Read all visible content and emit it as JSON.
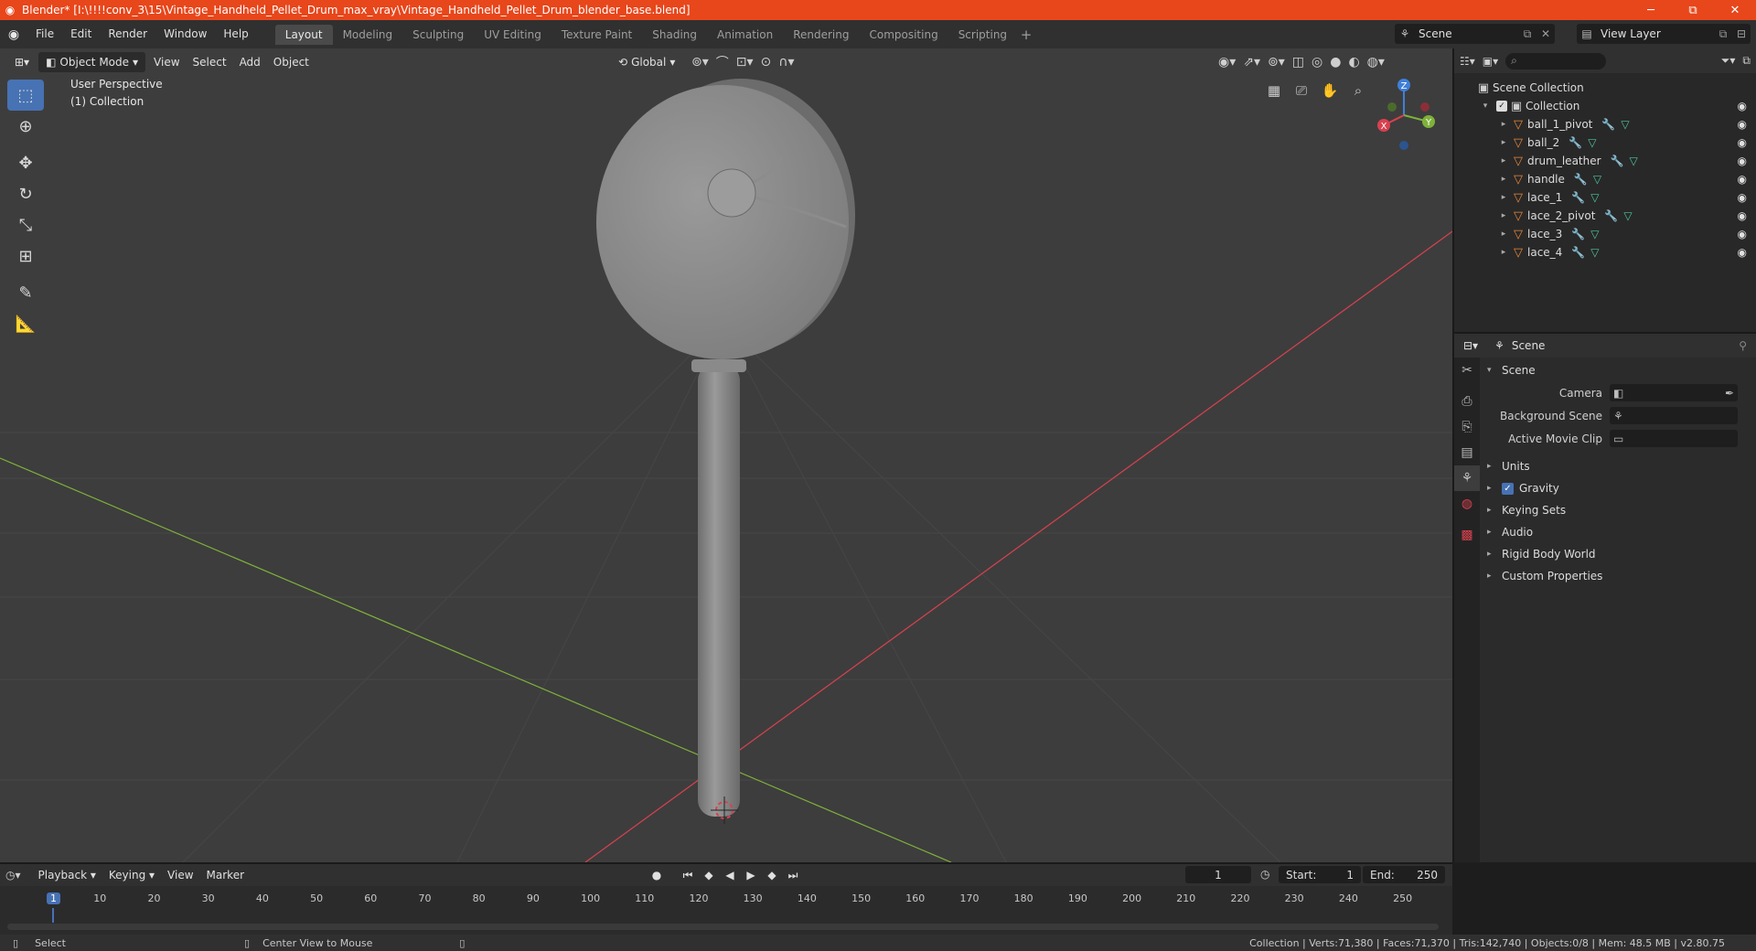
{
  "window": {
    "title": "Blender* [I:\\!!!!conv_3\\15\\Vintage_Handheld_Pellet_Drum_max_vray\\Vintage_Handheld_Pellet_Drum_blender_base.blend]",
    "minimize": "─",
    "maximize": "⧉",
    "close": "✕"
  },
  "menu": [
    "File",
    "Edit",
    "Render",
    "Window",
    "Help"
  ],
  "workspaces": [
    "Layout",
    "Modeling",
    "Sculpting",
    "UV Editing",
    "Texture Paint",
    "Shading",
    "Animation",
    "Rendering",
    "Compositing",
    "Scripting"
  ],
  "active_workspace": "Layout",
  "scene_selector": "Scene",
  "view_layer_selector": "View Layer",
  "viewport": {
    "mode": "Object Mode",
    "menus": [
      "View",
      "Select",
      "Add",
      "Object"
    ],
    "transform_orientation": "Global",
    "perspective_label": "User Perspective",
    "collection_label": "(1) Collection",
    "gizmo": {
      "x": "X",
      "y": "Y",
      "z": "Z"
    }
  },
  "tools": [
    "select-box",
    "cursor",
    "move",
    "rotate",
    "scale",
    "transform",
    "annotate",
    "measure"
  ],
  "outliner": {
    "root": "Scene Collection",
    "collection": "Collection",
    "objects": [
      "ball_1_pivot",
      "ball_2",
      "drum_leather",
      "handle",
      "lace_1",
      "lace_2_pivot",
      "lace_3",
      "lace_4"
    ]
  },
  "properties": {
    "header": "Scene",
    "panel": "Scene",
    "fields": [
      {
        "label": "Camera",
        "value": ""
      },
      {
        "label": "Background Scene",
        "value": ""
      },
      {
        "label": "Active Movie Clip",
        "value": ""
      }
    ],
    "subpanels": [
      "Units",
      "Gravity",
      "Keying Sets",
      "Audio",
      "Rigid Body World",
      "Custom Properties"
    ],
    "gravity_checked": true
  },
  "timeline": {
    "menus": [
      "Playback",
      "Keying",
      "View",
      "Marker"
    ],
    "current_frame": "1",
    "start_label": "Start:",
    "start": "1",
    "end_label": "End:",
    "end": "250",
    "ruler": [
      "1",
      "10",
      "20",
      "30",
      "40",
      "50",
      "60",
      "70",
      "80",
      "90",
      "100",
      "110",
      "120",
      "130",
      "140",
      "150",
      "160",
      "170",
      "180",
      "190",
      "200",
      "210",
      "220",
      "230",
      "240",
      "250"
    ]
  },
  "status": {
    "left": "Select",
    "middle": "Center View to Mouse",
    "right": "Collection | Verts:71,380 | Faces:71,370 | Tris:142,740 | Objects:0/8 | Mem: 48.5 MB | v2.80.75"
  },
  "colors": {
    "titlebar": "#e8461b",
    "accent": "#4772b3",
    "x_axis": "#d9414f",
    "y_axis": "#7fb23a",
    "z_axis": "#3f7fd9"
  }
}
